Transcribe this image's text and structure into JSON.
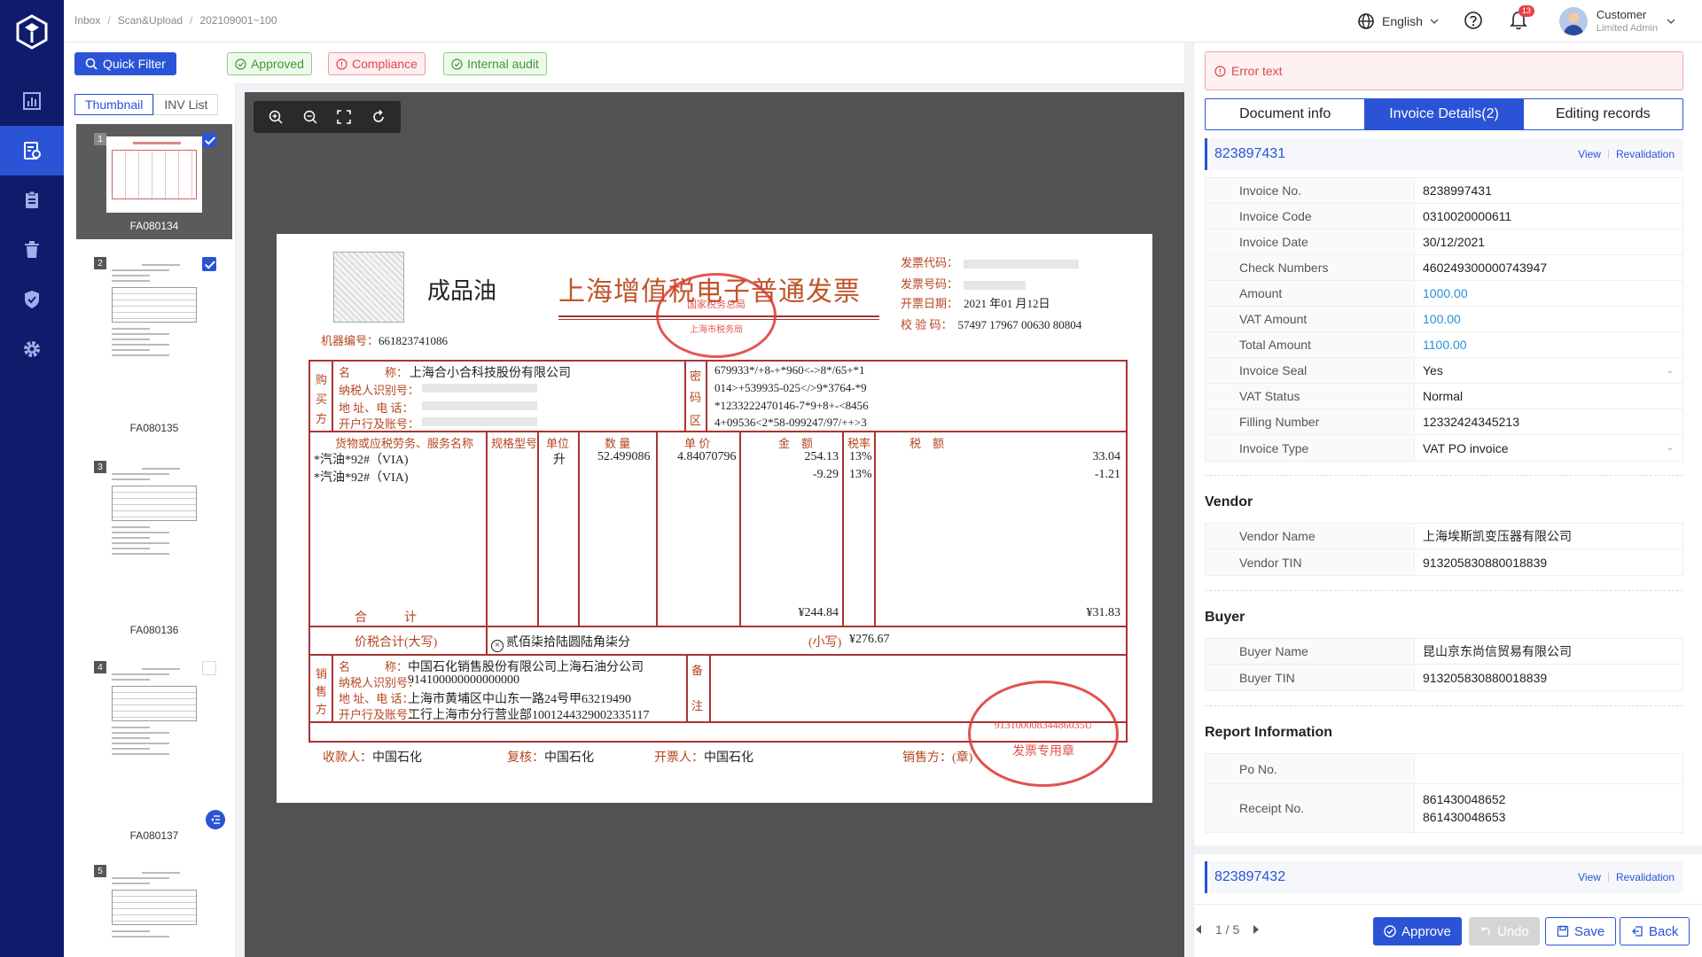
{
  "breadcrumb": [
    "Inbox",
    "Scan&Upload",
    "202109001~100"
  ],
  "topbar": {
    "language": "English",
    "notifications": "13",
    "user_name": "Customer",
    "user_role": "Limited Admin"
  },
  "filters": {
    "quick_filter": "Quick Filter",
    "tags": [
      "Approved",
      "Compliance",
      "Internal audit"
    ]
  },
  "thumbs": {
    "tabs": [
      "Thumbnail",
      "INV List"
    ],
    "items": [
      {
        "num": "1",
        "label": "FA080134",
        "checked": true
      },
      {
        "num": "2",
        "label": "FA080135",
        "checked": true
      },
      {
        "num": "3",
        "label": "FA080136",
        "checked": false
      },
      {
        "num": "4",
        "label": "FA080137",
        "checked": false
      },
      {
        "num": "5",
        "label": "",
        "checked": false
      }
    ]
  },
  "invoice_doc": {
    "product": "成品油",
    "title": "上海增值税电子普通发票",
    "code_label": "发票代码：",
    "number_label": "发票号码：",
    "date_label": "开票日期：",
    "date_value": "2021 年01 月12日",
    "check_label": "校 验 码：",
    "check_value": "57497 17967 00630 80804",
    "machine_label": "机器编号：",
    "machine_value": "661823741086",
    "buyer_side": [
      "购",
      "买",
      "方"
    ],
    "buyer_labels": [
      "名　　　称：",
      "纳税人识别号：",
      "地 址、电 话：",
      "开户行及账号："
    ],
    "buyer_name": "上海合小合科技股份有限公司",
    "cipher_side": [
      "密",
      "码",
      "区"
    ],
    "cipher": [
      "679933*/+8-+*960<->8*/65+*1",
      "014>+539935-025</>9*3764-*9",
      "*1233222470146-7*9+8+-<8456",
      "4+09536<2*58-099247/97/++>3"
    ],
    "col_headers": [
      "货物或应税劳务、服务名称",
      "规格型号",
      "单位",
      "数 量",
      "单 价",
      "金　额",
      "税率",
      "税　额"
    ],
    "rows": [
      {
        "name": "*汽油*92#（VIA)",
        "unit": "升",
        "qty": "52.499086",
        "price": "4.84070796",
        "amount": "254.13",
        "rate": "13%",
        "tax": "33.04"
      },
      {
        "name": "*汽油*92#（VIA)",
        "unit": "",
        "qty": "",
        "price": "",
        "amount": "-9.29",
        "rate": "13%",
        "tax": "-1.21"
      }
    ],
    "total_label": "合　　　计",
    "total_amount": "¥244.84",
    "total_tax": "¥31.83",
    "grand_label": "价税合计(大写)",
    "grand_words": "贰佰柒拾陆圆陆角柒分",
    "small_label": "(小写)",
    "grand_small": "¥276.67",
    "seller_side": [
      "销",
      "售",
      "方"
    ],
    "seller_labels": [
      "名　　　称：",
      "纳税人识别号：",
      "地 址、电 话：",
      "开户行及账号："
    ],
    "seller_values": [
      "中国石化销售股份有限公司上海石油分公司",
      "914100000000000000",
      "上海市黄埔区中山东一路24号甲63219490",
      "工行上海市分行营业部1001244329002335117"
    ],
    "remark_side": [
      "备",
      "注"
    ],
    "footer": [
      {
        "label": "收款人：",
        "value": "中国石化"
      },
      {
        "label": "复核：",
        "value": "中国石化"
      },
      {
        "label": "开票人：",
        "value": "中国石化"
      },
      {
        "label": "销售方：(章)",
        "value": ""
      }
    ],
    "stamp1_lines": [
      "国家税务总局",
      "上海市税务局"
    ],
    "stamp2_lines": [
      "91310000834486035U",
      "发票专用章"
    ]
  },
  "panel": {
    "error": "Error text",
    "tabs": [
      "Document info",
      "Invoice Details(2)",
      "Editing records"
    ],
    "invoice1": {
      "id": "823897431",
      "view": "View",
      "revalidation": "Revalidation",
      "fields": [
        {
          "key": "Invoice No.",
          "value": "8238997431"
        },
        {
          "key": "Invoice Code",
          "value": "0310020000611"
        },
        {
          "key": "Invoice Date",
          "value": "30/12/2021"
        },
        {
          "key": "Check Numbers",
          "value": "460249300000743947"
        },
        {
          "key": "Amount",
          "value": "1000.00"
        },
        {
          "key": "VAT Amount",
          "value": "100.00"
        },
        {
          "key": "Total Amount",
          "value": "1100.00"
        },
        {
          "key": "Invoice Seal",
          "value": "Yes"
        },
        {
          "key": "VAT Status",
          "value": "Normal"
        },
        {
          "key": "Filling Number",
          "value": "12332424345213"
        },
        {
          "key": "Invoice Type",
          "value": "VAT PO invoice"
        }
      ]
    },
    "vendor": {
      "title": "Vendor",
      "fields": [
        {
          "key": "Vendor Name",
          "value": "上海埃斯凯变压器有限公司"
        },
        {
          "key": "Vendor TIN",
          "value": "913205830880018839"
        }
      ]
    },
    "buyer": {
      "title": "Buyer",
      "fields": [
        {
          "key": "Buyer Name",
          "value": "昆山京东尚信贸易有限公司"
        },
        {
          "key": "Buyer TIN",
          "value": "913205830880018839"
        }
      ]
    },
    "report": {
      "title": "Report Information",
      "po_key": "Po No.",
      "po_value": "",
      "receipt_key": "Receipt No.",
      "receipt_values": [
        "861430048652",
        "861430048653"
      ]
    },
    "invoice2": {
      "id": "823897432",
      "view": "View",
      "revalidation": "Revalidation"
    }
  },
  "bottom": {
    "pager": "1 / 5",
    "approve": "Approve",
    "undo": "Undo",
    "save": "Save",
    "back": "Back"
  },
  "colors": {
    "primary": "#2a53d6",
    "sidebar": "#0e1c6b",
    "danger": "#e0454f",
    "success": "#3c9a2e"
  }
}
